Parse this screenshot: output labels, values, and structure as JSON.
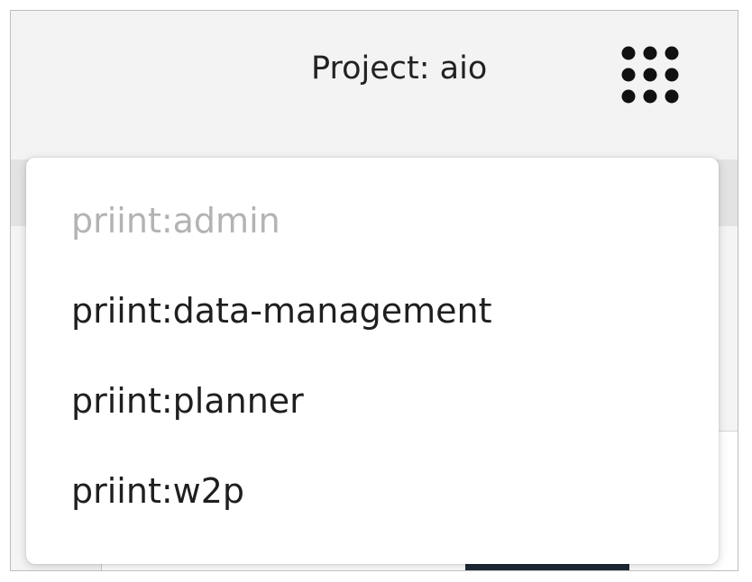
{
  "header": {
    "project_label": "Project: aio",
    "apps_icon": "grid-dots-icon"
  },
  "dropdown": {
    "items": [
      {
        "label": "priint:admin",
        "state": "disabled"
      },
      {
        "label": "priint:data-management",
        "state": "enabled"
      },
      {
        "label": "priint:planner",
        "state": "enabled"
      },
      {
        "label": "priint:w2p",
        "state": "enabled"
      }
    ]
  },
  "colors": {
    "text": "#1f1f1f",
    "disabled_text": "#b3b3b3",
    "header_bg": "#f3f3f3",
    "dropdown_bg": "#ffffff"
  }
}
